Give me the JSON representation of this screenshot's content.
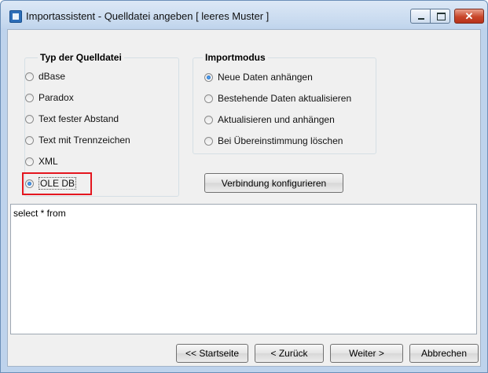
{
  "window": {
    "title": "Importassistent - Quelldatei angeben [ leeres Muster ]",
    "minimize_icon": "minimize-icon",
    "maximize_icon": "maximize-icon",
    "close_icon": "close-icon",
    "close_glyph": "✕"
  },
  "source_type": {
    "title": "Typ der Quelldatei",
    "options": [
      {
        "label": "dBase",
        "checked": false
      },
      {
        "label": "Paradox",
        "checked": false
      },
      {
        "label": "Text fester Abstand",
        "checked": false
      },
      {
        "label": "Text mit Trennzeichen",
        "checked": false
      },
      {
        "label": "XML",
        "checked": false
      },
      {
        "label": "OLE DB",
        "checked": true
      }
    ]
  },
  "import_mode": {
    "title": "Importmodus",
    "options": [
      {
        "label": "Neue Daten anhängen",
        "checked": true
      },
      {
        "label": "Bestehende Daten aktualisieren",
        "checked": false
      },
      {
        "label": "Aktualisieren und anhängen",
        "checked": false
      },
      {
        "label": "Bei Übereinstimmung löschen",
        "checked": false
      }
    ]
  },
  "buttons": {
    "configure_connection": "Verbindung konfigurieren",
    "start": "<< Startseite",
    "back": "< Zurück",
    "next": "Weiter >",
    "cancel": "Abbrechen"
  },
  "query": {
    "value": "select * from"
  },
  "colors": {
    "highlight": "#e4161f",
    "close_button": "#c8462a"
  }
}
